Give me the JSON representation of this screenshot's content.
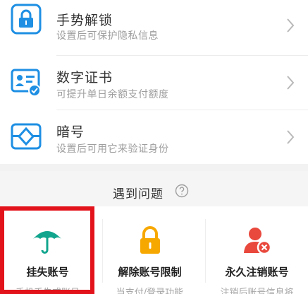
{
  "colors": {
    "accent_blue": "#1e8fe3",
    "green": "#12a58e",
    "orange": "#f7a800",
    "red": "#e9483d",
    "highlight_red": "#e3131b"
  },
  "rows": [
    {
      "title": "手势解锁",
      "subtitle": "设置后可保护隐私信息",
      "icon": "lock-icon"
    },
    {
      "title": "数字证书",
      "subtitle": "可提升单日余额支付额度",
      "icon": "certificate-icon"
    },
    {
      "title": "暗号",
      "subtitle": "设置后可用它来验证身份",
      "icon": "cipher-icon"
    }
  ],
  "problems": {
    "title": "遇到问题",
    "help_icon": "question-icon",
    "cards": [
      {
        "title": "挂失账号",
        "subtitle": "手机丢失或账号",
        "icon": "umbrella-icon"
      },
      {
        "title": "解除账号限制",
        "subtitle": "当支付/登录功能",
        "icon": "padlock-icon"
      },
      {
        "title": "永久注销账号",
        "subtitle": "注销后账号信息将",
        "icon": "user-remove-icon"
      }
    ]
  }
}
